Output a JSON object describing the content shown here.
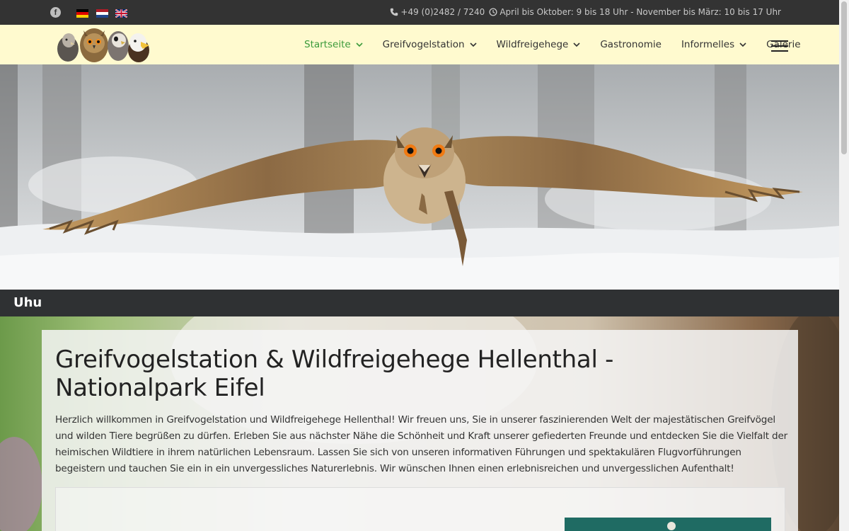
{
  "topbar": {
    "social": "f",
    "phone": "+49 (0)2482 / 7240",
    "hours": "April bis Oktober: 9 bis 18 Uhr - November bis März: 10 bis 17 Uhr",
    "languages": [
      "de",
      "nl",
      "en"
    ]
  },
  "nav": {
    "items": [
      {
        "label": "Startseite",
        "dropdown": true,
        "active": true
      },
      {
        "label": "Greifvogelstation",
        "dropdown": true
      },
      {
        "label": "Wildfreigehege",
        "dropdown": true
      },
      {
        "label": "Gastronomie",
        "dropdown": false
      },
      {
        "label": "Informelles",
        "dropdown": true
      },
      {
        "label": "Galerie",
        "dropdown": false
      }
    ],
    "active_color": "#3a9a3a"
  },
  "hero": {
    "caption": "Uhu"
  },
  "content": {
    "title": "Greifvogelstation & Wildfreigehege Hellenthal - Nationalpark Eifel",
    "intro": "Herzlich willkommen in Greifvogelstation und Wildfreigehege Hellenthal! Wir freuen uns, Sie in unserer faszinierenden Welt der majestätischen Greifvögel und wilden Tiere begrüßen zu dürfen. Erleben Sie aus nächster Nähe die Schönheit und Kraft unserer gefiederten Freunde und entdecken Sie die Vielfalt der heimischen Wildtiere in ihrem natürlichen Lebensraum. Lassen Sie sich von unseren informativen Führungen und spektakulären Flugvorführungen begeistern und tauchen Sie ein in ein unvergessliches Naturerlebnis. Wir wünschen Ihnen einen erlebnisreichen und unvergesslichen Aufenthalt!"
  },
  "colors": {
    "topbar": "#333333",
    "navbar": "#fffacf",
    "caption_bar": "#2f3133"
  }
}
